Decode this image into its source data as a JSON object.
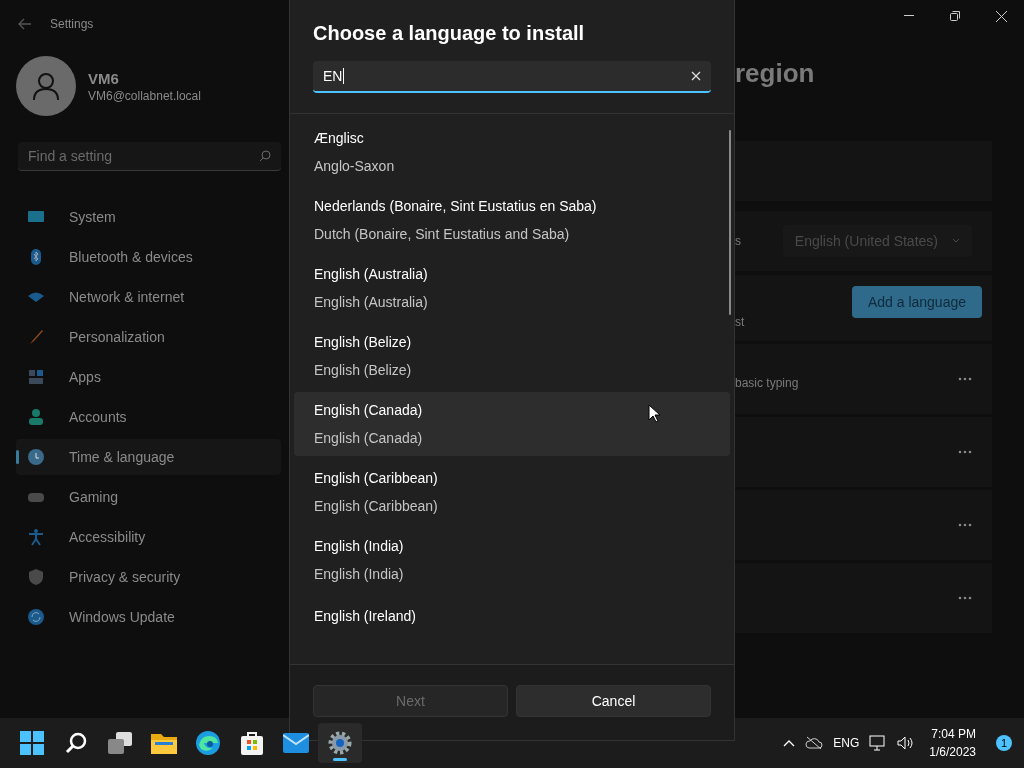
{
  "settings_window": {
    "title": "Settings",
    "user": {
      "name": "VM6",
      "email": "VM6@collabnet.local"
    },
    "search": {
      "placeholder": "Find a setting"
    },
    "nav": [
      {
        "label": "System",
        "selected": false,
        "color": "#1a6f8c"
      },
      {
        "label": "Bluetooth & devices",
        "selected": false,
        "color": "#1a5a8c"
      },
      {
        "label": "Network & internet",
        "selected": false,
        "color": "#1a5a8c"
      },
      {
        "label": "Personalization",
        "selected": false,
        "color": "#8c4a1a"
      },
      {
        "label": "Apps",
        "selected": false,
        "color": "#3a4a5a"
      },
      {
        "label": "Accounts",
        "selected": false,
        "color": "#1a7a6a"
      },
      {
        "label": "Time & language",
        "selected": true,
        "color": "#3a6a8a"
      },
      {
        "label": "Gaming",
        "selected": false,
        "color": "#4a4a4a"
      },
      {
        "label": "Accessibility",
        "selected": false,
        "color": "#1a5a8c"
      },
      {
        "label": "Privacy & security",
        "selected": false,
        "color": "#4a4a4a"
      },
      {
        "label": "Windows Update",
        "selected": false,
        "color": "#1a5a8c"
      }
    ],
    "page_title": "region",
    "display_language": {
      "label": "s",
      "value": "English (United States)"
    },
    "preferred_languages": {
      "label": "st",
      "button": "Add a language"
    },
    "language_rows": [
      {
        "kind": "detail",
        "detail": "basic typing"
      },
      {
        "kind": "blank"
      },
      {
        "kind": "blank"
      },
      {
        "kind": "blank"
      }
    ]
  },
  "dialog": {
    "title": "Choose a language to install",
    "search": {
      "value": "EN"
    },
    "languages": [
      {
        "name": "Ænglisc",
        "subtitle": "Anglo-Saxon",
        "hovered": false
      },
      {
        "name": "Nederlands (Bonaire, Sint Eustatius en Saba)",
        "subtitle": "Dutch (Bonaire, Sint Eustatius and Saba)",
        "hovered": false
      },
      {
        "name": "English (Australia)",
        "subtitle": "English (Australia)",
        "hovered": false
      },
      {
        "name": "English (Belize)",
        "subtitle": "English (Belize)",
        "hovered": false
      },
      {
        "name": "English (Canada)",
        "subtitle": "English (Canada)",
        "hovered": true
      },
      {
        "name": "English (Caribbean)",
        "subtitle": "English (Caribbean)",
        "hovered": false
      },
      {
        "name": "English (India)",
        "subtitle": "English (India)",
        "hovered": false
      },
      {
        "name": "English (Ireland)",
        "hovered": false
      }
    ],
    "buttons": [
      {
        "label": "Next",
        "disabled": true
      },
      {
        "label": "Cancel",
        "disabled": false
      }
    ]
  },
  "taskbar": {
    "apps": [
      {
        "kind": "start",
        "active": false
      },
      {
        "kind": "search",
        "active": false
      },
      {
        "kind": "taskview",
        "active": false
      },
      {
        "kind": "explorer",
        "active": false
      },
      {
        "kind": "edge",
        "active": false
      },
      {
        "kind": "store",
        "active": false
      },
      {
        "kind": "mail",
        "active": false
      },
      {
        "kind": "settings",
        "active": true
      }
    ],
    "language": "ENG",
    "time": "7:04 PM",
    "date": "1/6/2023",
    "notifications": "1"
  }
}
